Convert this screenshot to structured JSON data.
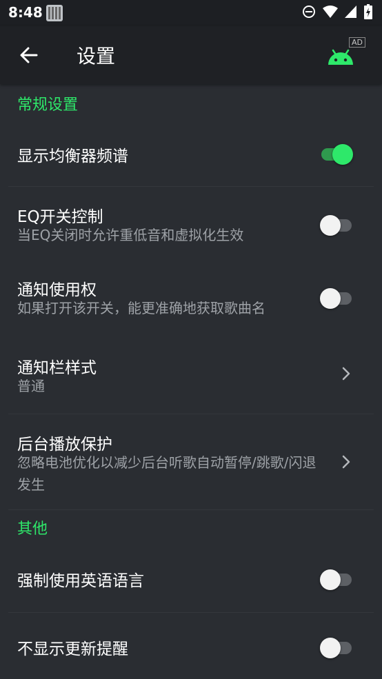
{
  "status_bar": {
    "time": "8:48"
  },
  "app_bar": {
    "title": "设置",
    "ad_tag": "AD"
  },
  "sections": {
    "general": {
      "header": "常规设置"
    },
    "other": {
      "header": "其他"
    }
  },
  "settings": {
    "equalizer_spectrum": {
      "title": "显示均衡器频谱",
      "enabled": true
    },
    "eq_switch": {
      "title": "EQ开关控制",
      "subtitle": "当EQ关闭时允许重低音和虚拟化生效",
      "enabled": false
    },
    "notification_access": {
      "title": "通知使用权",
      "subtitle": "如果打开该开关，能更准确地获取歌曲名",
      "enabled": false
    },
    "notification_style": {
      "title": "通知栏样式",
      "subtitle": "普通"
    },
    "background_protection": {
      "title": "后台播放保护",
      "subtitle": "忽略电池优化以减少后台听歌自动暂停/跳歌/闪退发生"
    },
    "force_english": {
      "title": "强制使用英语语言",
      "enabled": false
    },
    "hide_update_reminder": {
      "title": "不显示更新提醒",
      "enabled": false
    }
  },
  "colors": {
    "accent": "#2ee86a",
    "background": "#2a2d32",
    "app_bar": "#1f2125",
    "status_bar": "#1d1f23"
  }
}
